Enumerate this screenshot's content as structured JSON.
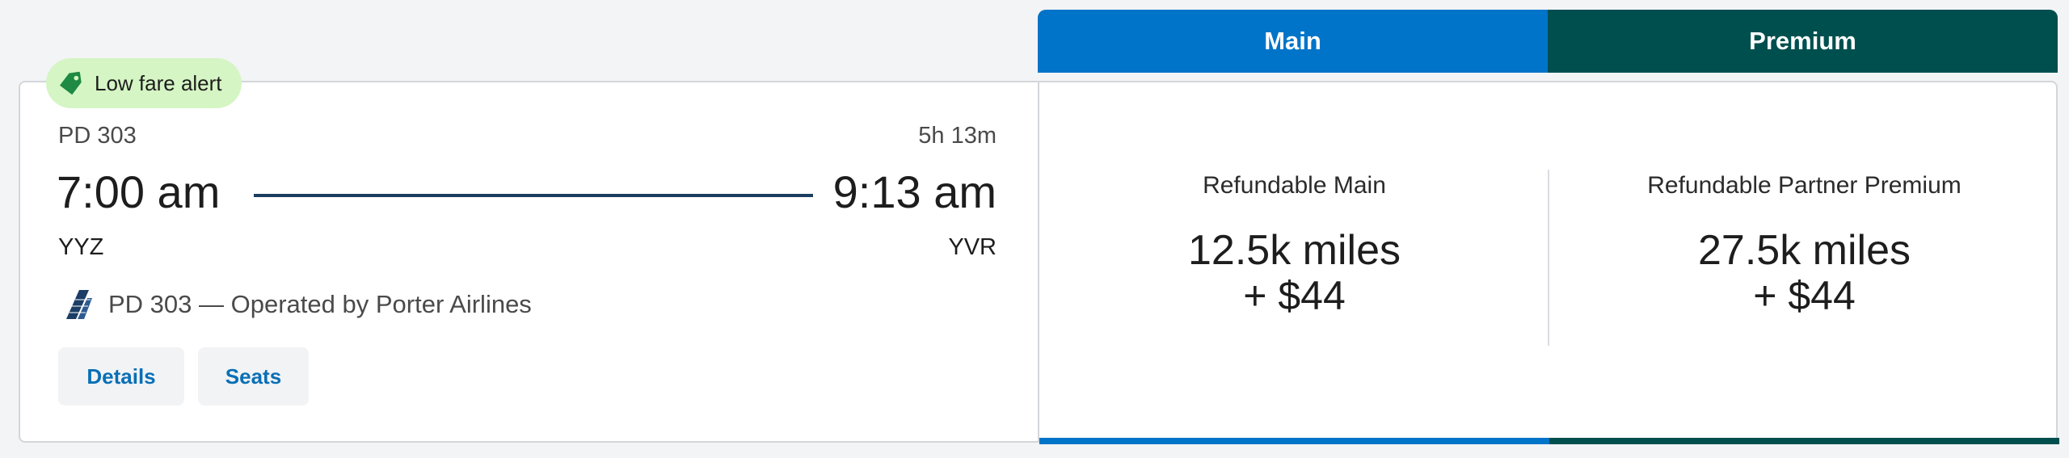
{
  "fare_tabs": [
    {
      "label": "Main",
      "color": "#0074c8"
    },
    {
      "label": "Premium",
      "color": "#004f4f"
    }
  ],
  "alert": {
    "label": "Low fare alert",
    "icon": "tag-icon",
    "background": "#d5f5c4"
  },
  "flight": {
    "number": "PD 303",
    "duration": "5h 13m",
    "departure_time": "7:00 am",
    "arrival_time": "9:13 am",
    "origin": "YYZ",
    "destination": "YVR",
    "operator_text": "PD 303 — Operated by Porter Airlines",
    "airline_logo_icon": "porter-airlines-logo-icon"
  },
  "actions": {
    "details_label": "Details",
    "seats_label": "Seats"
  },
  "fares": [
    {
      "name": "Refundable Main",
      "miles": "12.5k miles",
      "price": "+ $44"
    },
    {
      "name": "Refundable Partner Premium",
      "miles": "27.5k miles",
      "price": "+ $44"
    }
  ]
}
